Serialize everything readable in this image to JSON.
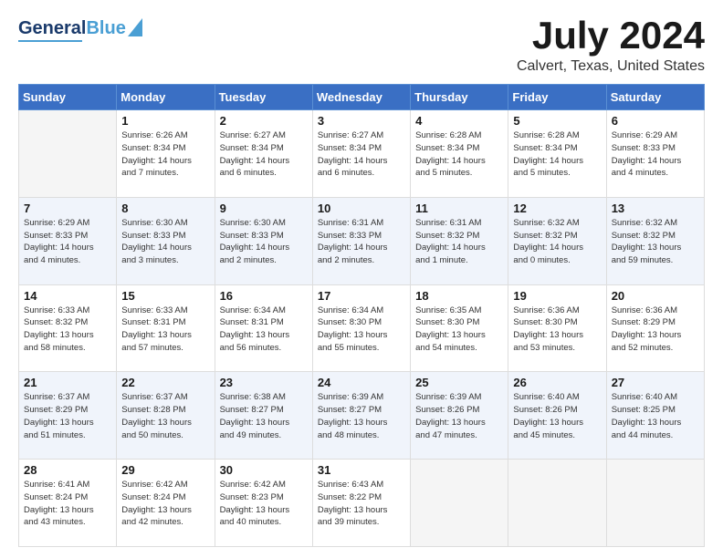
{
  "header": {
    "logo_line1": "General",
    "logo_line2": "Blue",
    "month": "July 2024",
    "location": "Calvert, Texas, United States"
  },
  "weekdays": [
    "Sunday",
    "Monday",
    "Tuesday",
    "Wednesday",
    "Thursday",
    "Friday",
    "Saturday"
  ],
  "weeks": [
    [
      {
        "day": "",
        "info": ""
      },
      {
        "day": "1",
        "info": "Sunrise: 6:26 AM\nSunset: 8:34 PM\nDaylight: 14 hours\nand 7 minutes."
      },
      {
        "day": "2",
        "info": "Sunrise: 6:27 AM\nSunset: 8:34 PM\nDaylight: 14 hours\nand 6 minutes."
      },
      {
        "day": "3",
        "info": "Sunrise: 6:27 AM\nSunset: 8:34 PM\nDaylight: 14 hours\nand 6 minutes."
      },
      {
        "day": "4",
        "info": "Sunrise: 6:28 AM\nSunset: 8:34 PM\nDaylight: 14 hours\nand 5 minutes."
      },
      {
        "day": "5",
        "info": "Sunrise: 6:28 AM\nSunset: 8:34 PM\nDaylight: 14 hours\nand 5 minutes."
      },
      {
        "day": "6",
        "info": "Sunrise: 6:29 AM\nSunset: 8:33 PM\nDaylight: 14 hours\nand 4 minutes."
      }
    ],
    [
      {
        "day": "7",
        "info": "Sunrise: 6:29 AM\nSunset: 8:33 PM\nDaylight: 14 hours\nand 4 minutes."
      },
      {
        "day": "8",
        "info": "Sunrise: 6:30 AM\nSunset: 8:33 PM\nDaylight: 14 hours\nand 3 minutes."
      },
      {
        "day": "9",
        "info": "Sunrise: 6:30 AM\nSunset: 8:33 PM\nDaylight: 14 hours\nand 2 minutes."
      },
      {
        "day": "10",
        "info": "Sunrise: 6:31 AM\nSunset: 8:33 PM\nDaylight: 14 hours\nand 2 minutes."
      },
      {
        "day": "11",
        "info": "Sunrise: 6:31 AM\nSunset: 8:32 PM\nDaylight: 14 hours\nand 1 minute."
      },
      {
        "day": "12",
        "info": "Sunrise: 6:32 AM\nSunset: 8:32 PM\nDaylight: 14 hours\nand 0 minutes."
      },
      {
        "day": "13",
        "info": "Sunrise: 6:32 AM\nSunset: 8:32 PM\nDaylight: 13 hours\nand 59 minutes."
      }
    ],
    [
      {
        "day": "14",
        "info": "Sunrise: 6:33 AM\nSunset: 8:32 PM\nDaylight: 13 hours\nand 58 minutes."
      },
      {
        "day": "15",
        "info": "Sunrise: 6:33 AM\nSunset: 8:31 PM\nDaylight: 13 hours\nand 57 minutes."
      },
      {
        "day": "16",
        "info": "Sunrise: 6:34 AM\nSunset: 8:31 PM\nDaylight: 13 hours\nand 56 minutes."
      },
      {
        "day": "17",
        "info": "Sunrise: 6:34 AM\nSunset: 8:30 PM\nDaylight: 13 hours\nand 55 minutes."
      },
      {
        "day": "18",
        "info": "Sunrise: 6:35 AM\nSunset: 8:30 PM\nDaylight: 13 hours\nand 54 minutes."
      },
      {
        "day": "19",
        "info": "Sunrise: 6:36 AM\nSunset: 8:30 PM\nDaylight: 13 hours\nand 53 minutes."
      },
      {
        "day": "20",
        "info": "Sunrise: 6:36 AM\nSunset: 8:29 PM\nDaylight: 13 hours\nand 52 minutes."
      }
    ],
    [
      {
        "day": "21",
        "info": "Sunrise: 6:37 AM\nSunset: 8:29 PM\nDaylight: 13 hours\nand 51 minutes."
      },
      {
        "day": "22",
        "info": "Sunrise: 6:37 AM\nSunset: 8:28 PM\nDaylight: 13 hours\nand 50 minutes."
      },
      {
        "day": "23",
        "info": "Sunrise: 6:38 AM\nSunset: 8:27 PM\nDaylight: 13 hours\nand 49 minutes."
      },
      {
        "day": "24",
        "info": "Sunrise: 6:39 AM\nSunset: 8:27 PM\nDaylight: 13 hours\nand 48 minutes."
      },
      {
        "day": "25",
        "info": "Sunrise: 6:39 AM\nSunset: 8:26 PM\nDaylight: 13 hours\nand 47 minutes."
      },
      {
        "day": "26",
        "info": "Sunrise: 6:40 AM\nSunset: 8:26 PM\nDaylight: 13 hours\nand 45 minutes."
      },
      {
        "day": "27",
        "info": "Sunrise: 6:40 AM\nSunset: 8:25 PM\nDaylight: 13 hours\nand 44 minutes."
      }
    ],
    [
      {
        "day": "28",
        "info": "Sunrise: 6:41 AM\nSunset: 8:24 PM\nDaylight: 13 hours\nand 43 minutes."
      },
      {
        "day": "29",
        "info": "Sunrise: 6:42 AM\nSunset: 8:24 PM\nDaylight: 13 hours\nand 42 minutes."
      },
      {
        "day": "30",
        "info": "Sunrise: 6:42 AM\nSunset: 8:23 PM\nDaylight: 13 hours\nand 40 minutes."
      },
      {
        "day": "31",
        "info": "Sunrise: 6:43 AM\nSunset: 8:22 PM\nDaylight: 13 hours\nand 39 minutes."
      },
      {
        "day": "",
        "info": ""
      },
      {
        "day": "",
        "info": ""
      },
      {
        "day": "",
        "info": ""
      }
    ]
  ]
}
